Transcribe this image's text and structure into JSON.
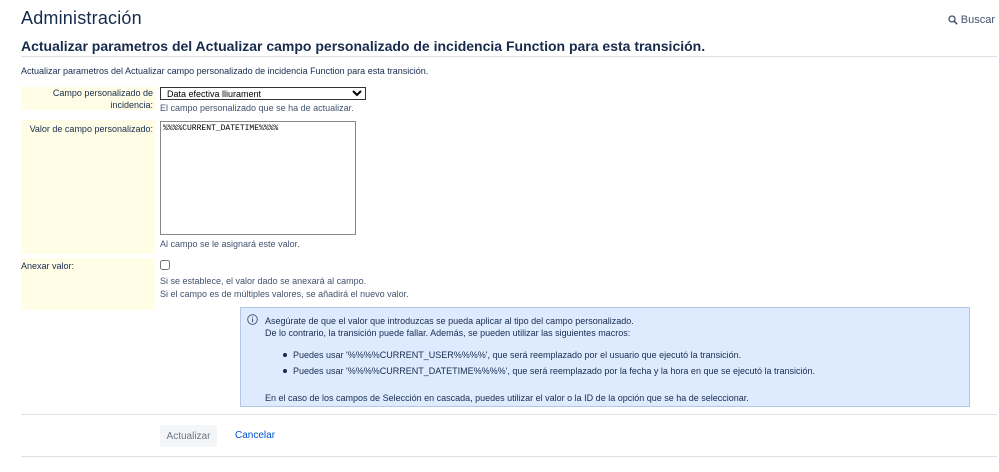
{
  "header": {
    "title": "Administración",
    "search_label": "Buscar"
  },
  "page": {
    "title": "Actualizar parametros del Actualizar campo personalizado de incidencia Function para esta transición.",
    "description": "Actualizar parametros del Actualizar campo personalizado de incidencia Function para esta transición."
  },
  "form": {
    "field_label_line1": "Campo personalizado de",
    "field_label_line2": "incidencia:",
    "field_selected": "Data efectiva lliurament",
    "field_help": "El campo personalizado que se ha de actualizar.",
    "value_label": "Valor de campo personalizado:",
    "value_text": "%%%%CURRENT_DATETIME%%%%",
    "value_help": "Al campo se le asignará este valor.",
    "append_label": "Anexar valor:",
    "append_checked": false,
    "append_help1": "Si se establece, el valor dado se anexará al campo.",
    "append_help2": "Si el campo es de múltiples valores, se añadirá el nuevo valor."
  },
  "info": {
    "line1": "Asegúrate de que el valor que introduzcas se pueda aplicar al tipo del campo personalizado.",
    "line2": "De lo contrario, la transición puede fallar. Además, se pueden utilizar las siguientes macros:",
    "bullets": [
      "Puedes usar '%%%%CURRENT_USER%%%%', que será reemplazado por el usuario que ejecutó la transición.",
      "Puedes usar '%%%%CURRENT_DATETIME%%%%', que será reemplazado por la fecha y la hora en que se ejecutó la transición."
    ],
    "footer": "En el caso de los campos de Selección en cascada, puedes utilizar el valor o la ID de la opción que se ha de seleccionar."
  },
  "actions": {
    "update_label": "Actualizar",
    "cancel_label": "Cancelar"
  }
}
